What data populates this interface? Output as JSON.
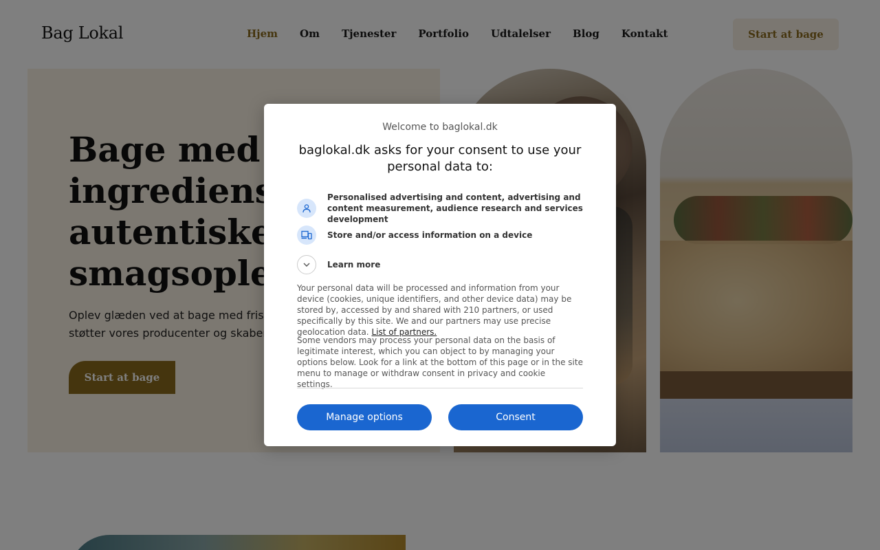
{
  "header": {
    "logo": "Bag Lokal",
    "nav": [
      {
        "label": "Hjem",
        "active": true
      },
      {
        "label": "Om"
      },
      {
        "label": "Tjenester"
      },
      {
        "label": "Portfolio"
      },
      {
        "label": "Udtalelser"
      },
      {
        "label": "Blog"
      },
      {
        "label": "Kontakt"
      }
    ],
    "cta_label": "Start at bage"
  },
  "hero": {
    "title": "Bage med lokale\ningredienser for\nautentiske\nsmagsoplevelser",
    "text": "Oplev glæden ved at bage med friske, lokale råvarer, der\nstøtter vores producenter og skaber lækre resultater.",
    "button_label": "Start at bage"
  },
  "consent_dialog": {
    "welcome": "Welcome to baglokal.dk",
    "heading": "baglokal.dk asks for your consent to use your personal data to:",
    "purposes": [
      {
        "icon": "person-icon",
        "label": "Personalised advertising and content, advertising and content measurement, audience research and services development"
      },
      {
        "icon": "devices-icon",
        "label": "Store and/or access information on a device"
      }
    ],
    "learn_more_label": "Learn more",
    "paragraph1": "Your personal data will be processed and information from your device (cookies, unique identifiers, and other device data) may be stored by, accessed by and shared with 210 partners, or used specifically by this site. We and our partners may use precise geolocation data.",
    "partners_link": "List of partners.",
    "paragraph2": "Some vendors may process your personal data on the basis of legitimate interest, which you can object to by managing your options below. Look for a link at the bottom of this page or in the site menu to manage or withdraw consent in privacy and cookie settings.",
    "manage_label": "Manage options",
    "consent_label": "Consent"
  },
  "colors": {
    "brand": "#8a6a1c",
    "hero_bg": "#f9f0e2",
    "dialog_button": "#1a66d0"
  }
}
